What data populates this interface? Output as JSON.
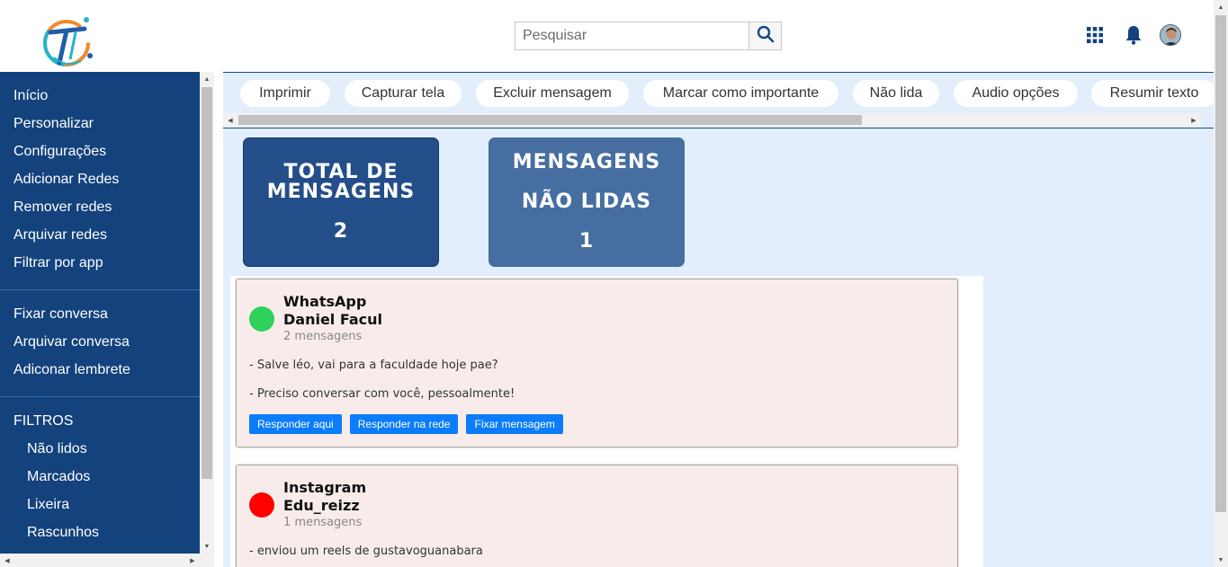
{
  "header": {
    "search": {
      "placeholder": "Pesquisar",
      "value": ""
    },
    "icons": [
      "logo-icon",
      "search-icon",
      "apps-grid-icon",
      "bell-icon",
      "user-avatar"
    ]
  },
  "sidebar": {
    "section1": [
      "Início",
      "Personalizar",
      "Configurações",
      "Adicionar Redes",
      "Remover redes",
      "Arquivar redes",
      "Filtrar por app"
    ],
    "section2": [
      "Fixar conversa",
      "Arquivar conversa",
      "Adiconar lembrete"
    ],
    "filters_title": "FILTROS",
    "filters": [
      "Não lidos",
      "Marcados",
      "Lixeira",
      "Rascunhos"
    ]
  },
  "toolbar": {
    "chips": [
      "Imprimir",
      "Capturar tela",
      "Excluir mensagem",
      "Marcar como importante",
      "Não lida",
      "Audio opções",
      "Resumir texto"
    ]
  },
  "stats": {
    "total": {
      "title_line1": "TOTAL DE",
      "title_line2": "MENSAGENS",
      "value": "2"
    },
    "unread": {
      "title_line1": "MENSAGENS",
      "title_line2": "NÃO LIDAS",
      "value": "1"
    }
  },
  "messages": [
    {
      "app": "WhatsApp",
      "contact": "Daniel Facul",
      "count": "2 mensagens",
      "status_color": "#2ed15a",
      "lines": [
        "- Salve léo, vai para a faculdade hoje pae?",
        "- Preciso conversar com você, pessoalmente!"
      ],
      "actions": [
        "Responder aqui",
        "Responder na rede",
        "Fixar mensagem"
      ]
    },
    {
      "app": "Instagram",
      "contact": "Edu_reizz",
      "count": "1 mensagens",
      "status_color": "#ff0000",
      "lines": [
        "- enviou um reels de gustavoguanabara"
      ]
    }
  ],
  "colors": {
    "sidebar": "#13427d",
    "main_bg": "#e2eefc",
    "card_total": "#234e89",
    "card_unread": "#466ea1",
    "action_button": "#0b7dfb"
  }
}
